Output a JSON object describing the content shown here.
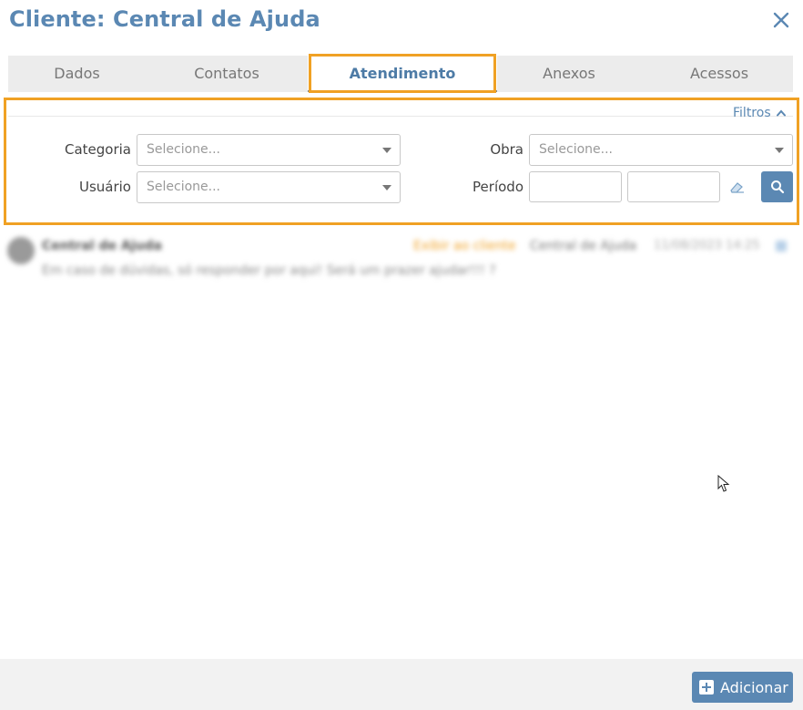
{
  "window": {
    "title": "Cliente: Central de Ajuda"
  },
  "tabs": [
    {
      "label": "Dados",
      "active": false
    },
    {
      "label": "Contatos",
      "active": false
    },
    {
      "label": "Atendimento",
      "active": true
    },
    {
      "label": "Anexos",
      "active": false
    },
    {
      "label": "Acessos",
      "active": false
    }
  ],
  "filters": {
    "toggle_label": "Filtros",
    "categoria": {
      "label": "Categoria",
      "placeholder": "Selecione..."
    },
    "obra": {
      "label": "Obra",
      "placeholder": "Selecione..."
    },
    "usuario": {
      "label": "Usuário",
      "placeholder": "Selecione..."
    },
    "periodo": {
      "label": "Período",
      "start": "",
      "end": ""
    }
  },
  "messages": [
    {
      "author": "Central de Ajuda",
      "tag": "Exibir ao cliente",
      "recipient": "Central de Ajuda",
      "timestamp": "11/08/2023 14:25",
      "text": "Em caso de dúvidas, só responder por aqui! Será um prazer ajudar!!! ?"
    }
  ],
  "footer": {
    "add_label": "Adicionar"
  },
  "colors": {
    "accent": "#5b88b3",
    "highlight": "#f0a124",
    "footer_bg": "#f2f2f2"
  },
  "icons": {
    "close": "close-icon",
    "filters": "chevron-up-icon",
    "eraser": "eraser-icon",
    "search": "search-icon",
    "add": "plus-square-icon"
  }
}
